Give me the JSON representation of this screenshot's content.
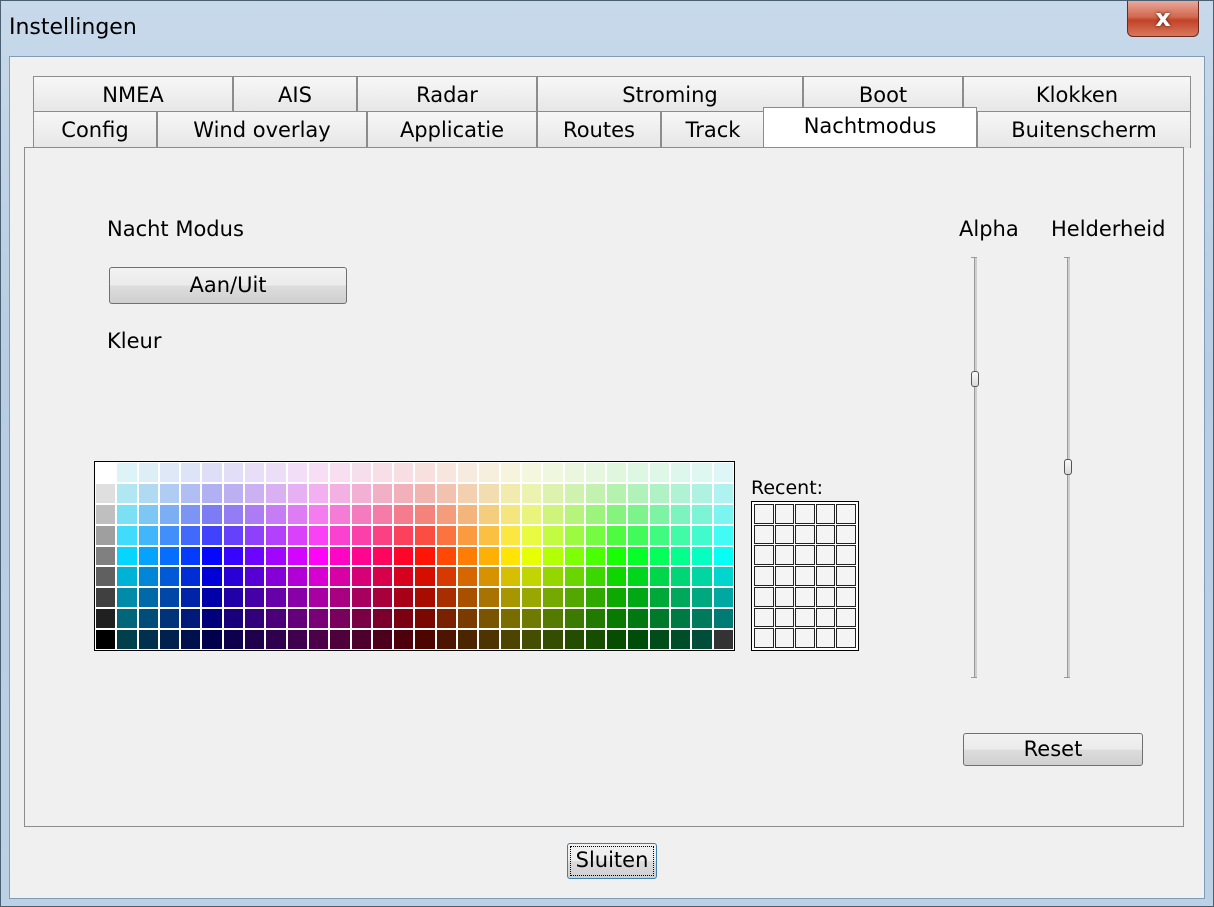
{
  "window": {
    "title": "Instellingen",
    "close_glyph": "x"
  },
  "tabs_row1": [
    "NMEA",
    "AIS",
    "Radar",
    "Stroming",
    "Boot",
    "Klokken"
  ],
  "tabs_row2": [
    "Config",
    "Wind overlay",
    "Applicatie",
    "Routes",
    "Track",
    "Nachtmodus",
    "Buitenscherm"
  ],
  "active_tab": "Nachtmodus",
  "night": {
    "title": "Nacht Modus",
    "toggle_label": "Aan/Uit",
    "color_label": "Kleur",
    "recent_label": "Recent:"
  },
  "sliders": {
    "alpha_label": "Alpha",
    "brightness_label": "Helderheid",
    "alpha_value": 0.29,
    "brightness_value": 0.5
  },
  "reset_label": "Reset",
  "close_label": "Sluiten"
}
